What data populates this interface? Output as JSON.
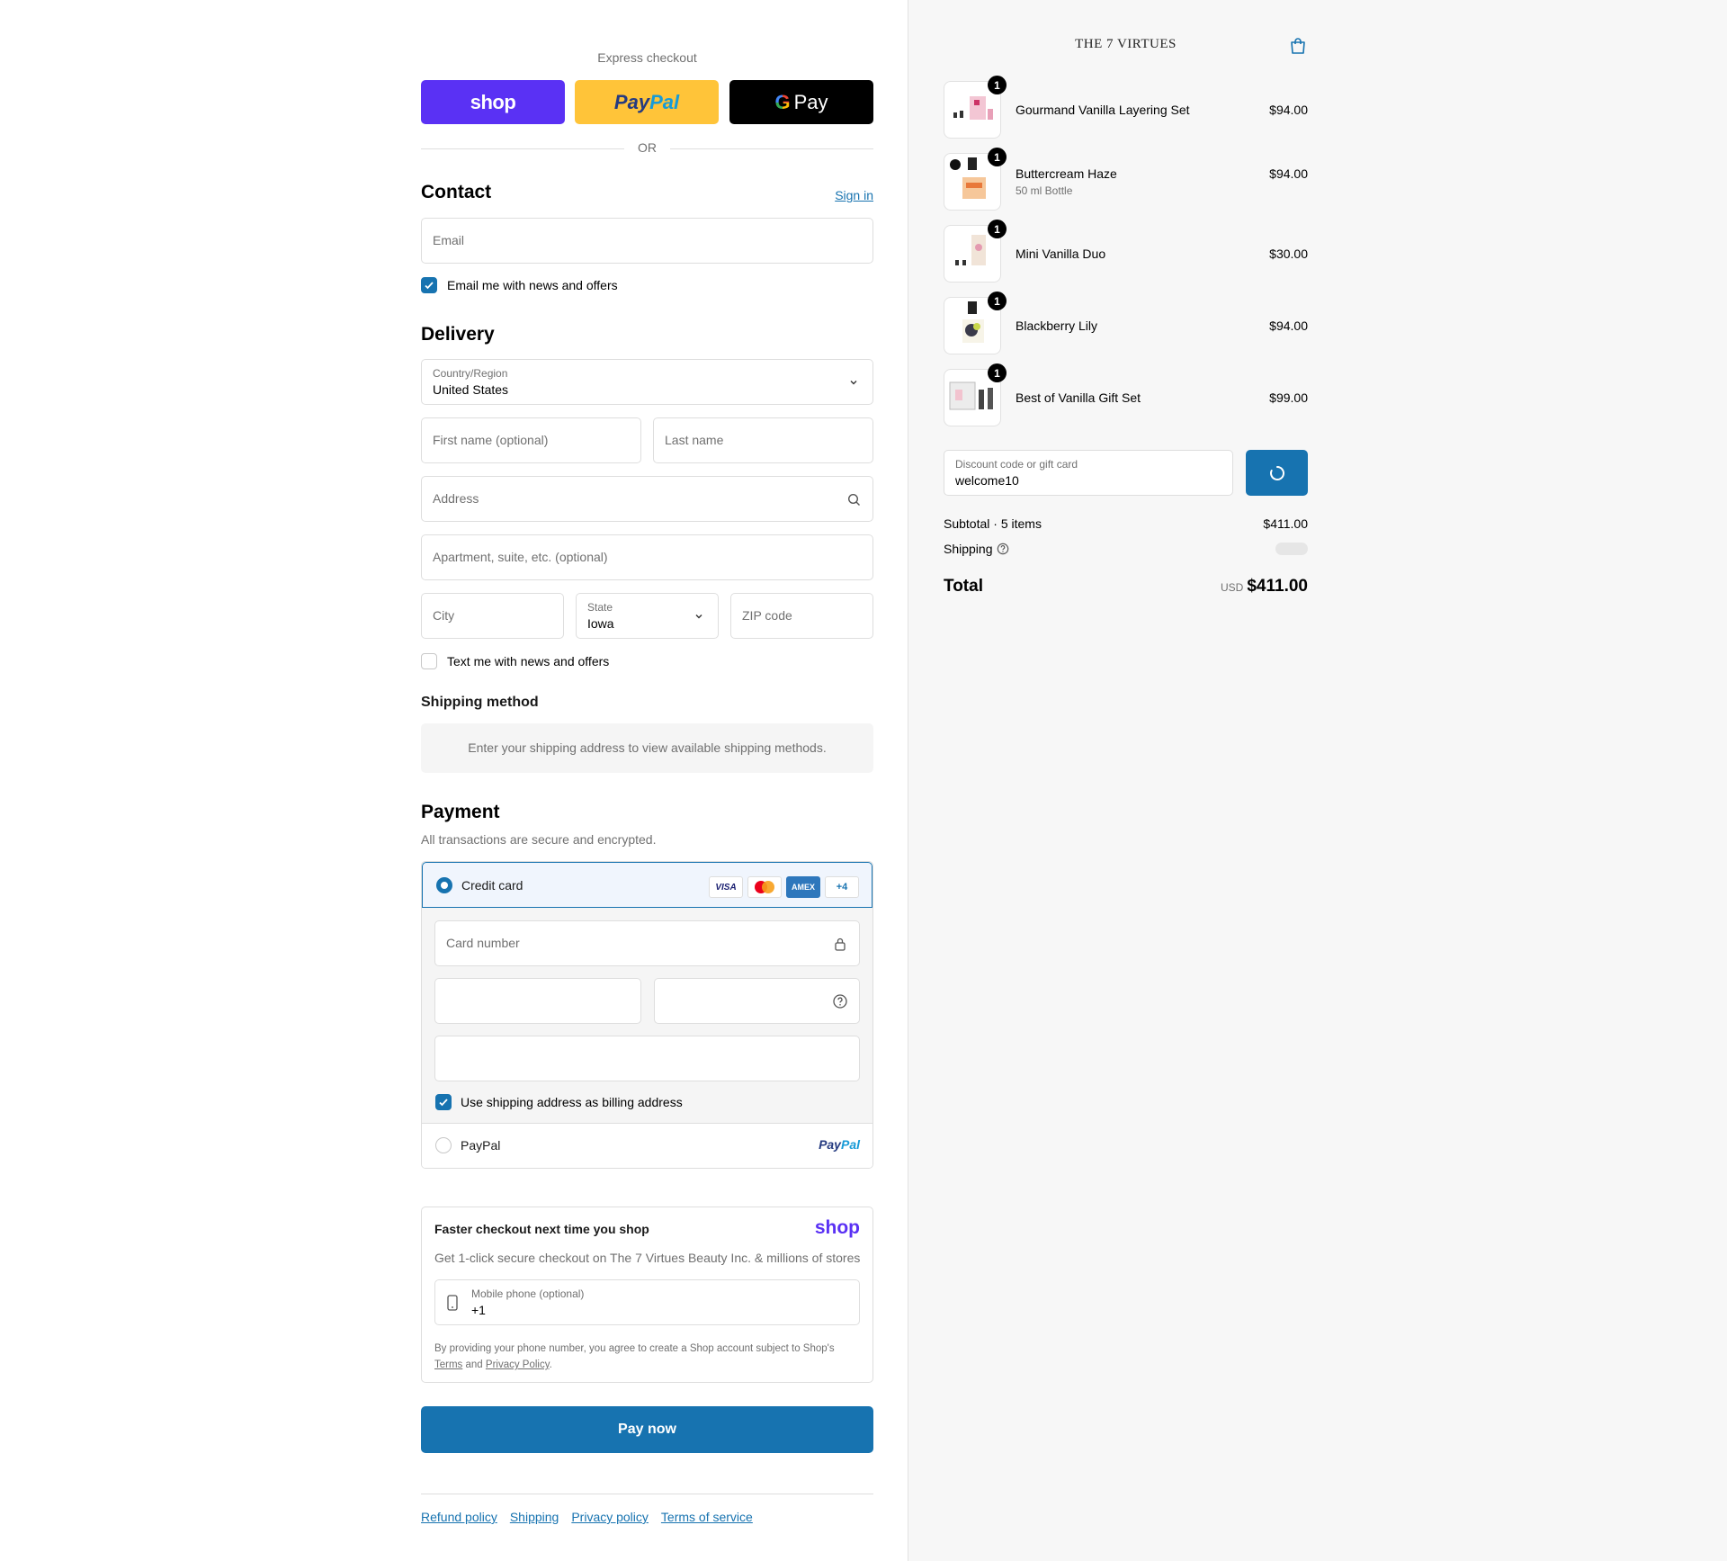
{
  "express": {
    "title": "Express checkout",
    "shop_label": "shop",
    "paypal_a": "Pay",
    "paypal_b": "Pal",
    "gpay_g": "G",
    "gpay_label": "Pay",
    "or": "OR"
  },
  "contact": {
    "heading": "Contact",
    "sign_in": "Sign in",
    "email_placeholder": "Email",
    "email_offers": "Email me with news and offers",
    "email_offers_checked": true
  },
  "delivery": {
    "heading": "Delivery",
    "country_label": "Country/Region",
    "country_value": "United States",
    "first_name_placeholder": "First name (optional)",
    "last_name_placeholder": "Last name",
    "address_placeholder": "Address",
    "apartment_placeholder": "Apartment, suite, etc. (optional)",
    "city_placeholder": "City",
    "state_label": "State",
    "state_value": "Iowa",
    "zip_placeholder": "ZIP code",
    "text_offers": "Text me with news and offers",
    "text_offers_checked": false
  },
  "shipping_method": {
    "heading": "Shipping method",
    "message": "Enter your shipping address to view available shipping methods."
  },
  "payment": {
    "heading": "Payment",
    "subtitle": "All transactions are secure and encrypted.",
    "credit_card_label": "Credit card",
    "card_logos": [
      "VISA",
      "mastercard",
      "AMEX",
      "+4"
    ],
    "card_number_placeholder": "Card number",
    "billing_same": "Use shipping address as billing address",
    "billing_same_checked": true,
    "paypal_label": "PayPal",
    "paypal_logo_a": "Pay",
    "paypal_logo_b": "Pal"
  },
  "faster": {
    "heading": "Faster checkout next time you shop",
    "shop_logo": "shop",
    "description": "Get 1-click secure checkout on The 7 Virtues Beauty Inc. & millions of stores",
    "phone_label": "Mobile phone (optional)",
    "phone_value": "+1",
    "legal_pre": "By providing your phone number, you agree to create a Shop account subject to Shop's",
    "legal_terms": "Terms",
    "legal_and": "and",
    "legal_privacy": "Privacy Policy",
    "legal_end": "."
  },
  "pay_now": "Pay now",
  "footer_links": [
    "Refund policy",
    "Shipping",
    "Privacy policy",
    "Terms of service"
  ],
  "summary": {
    "brand": "THE 7 VIRTUES",
    "items": [
      {
        "name": "Gourmand Vanilla Layering Set",
        "variant": "",
        "price": "$94.00",
        "qty": "1"
      },
      {
        "name": "Buttercream Haze",
        "variant": "50 ml Bottle",
        "price": "$94.00",
        "qty": "1"
      },
      {
        "name": "Mini Vanilla Duo",
        "variant": "",
        "price": "$30.00",
        "qty": "1"
      },
      {
        "name": "Blackberry Lily",
        "variant": "",
        "price": "$94.00",
        "qty": "1"
      },
      {
        "name": "Best of Vanilla Gift Set",
        "variant": "",
        "price": "$99.00",
        "qty": "1"
      }
    ],
    "discount_label": "Discount code or gift card",
    "discount_value": "welcome10",
    "subtotal_label": "Subtotal · 5 items",
    "subtotal_value": "$411.00",
    "shipping_label": "Shipping",
    "total_label": "Total",
    "currency": "USD",
    "total_value": "$411.00"
  },
  "colors": {
    "accent": "#1773b0",
    "shop_purple": "#5a31f4",
    "paypal_yellow": "#ffc439"
  }
}
